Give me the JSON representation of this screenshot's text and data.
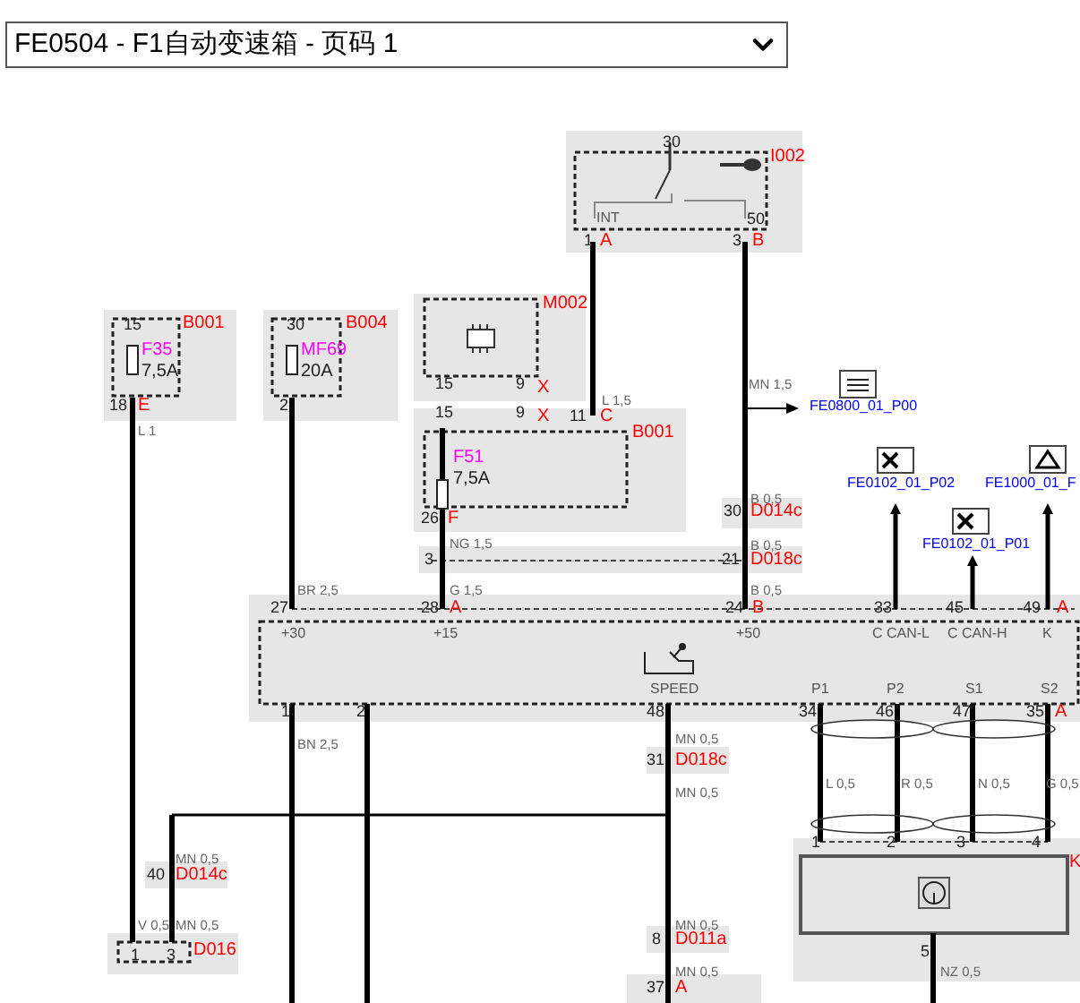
{
  "selector": {
    "value": "FE0504 - F1自动变速箱 - 页码 1"
  },
  "labels": [
    {
      "text": "30",
      "kind": "pin"
    },
    {
      "text": "I002",
      "kind": "connector"
    },
    {
      "text": "INT",
      "kind": "signal"
    },
    {
      "text": "50",
      "kind": "pin"
    },
    {
      "text": "1",
      "kind": "pin"
    },
    {
      "text": "A",
      "kind": "connector"
    },
    {
      "text": "3",
      "kind": "pin"
    },
    {
      "text": "B",
      "kind": "connector"
    },
    {
      "text": "15",
      "kind": "pin"
    },
    {
      "text": "F35",
      "kind": "fuse"
    },
    {
      "text": "7,5A",
      "kind": "rating"
    },
    {
      "text": "B001",
      "kind": "connector"
    },
    {
      "text": "18",
      "kind": "pin"
    },
    {
      "text": "E",
      "kind": "connector"
    },
    {
      "text": "L 1",
      "kind": "wire"
    },
    {
      "text": "30",
      "kind": "pin"
    },
    {
      "text": "MF69",
      "kind": "fuse"
    },
    {
      "text": "20A",
      "kind": "rating"
    },
    {
      "text": "B004",
      "kind": "connector"
    },
    {
      "text": "2",
      "kind": "pin"
    },
    {
      "text": "M002",
      "kind": "connector"
    },
    {
      "text": "15",
      "kind": "pin"
    },
    {
      "text": "9",
      "kind": "pin"
    },
    {
      "text": "X",
      "kind": "connector"
    },
    {
      "text": "L 1,5",
      "kind": "wire"
    },
    {
      "text": "15",
      "kind": "pin"
    },
    {
      "text": "9",
      "kind": "pin"
    },
    {
      "text": "X",
      "kind": "connector"
    },
    {
      "text": "11",
      "kind": "pin"
    },
    {
      "text": "C",
      "kind": "connector"
    },
    {
      "text": "B001",
      "kind": "connector"
    },
    {
      "text": "F51",
      "kind": "fuse"
    },
    {
      "text": "7,5A",
      "kind": "rating"
    },
    {
      "text": "26",
      "kind": "pin"
    },
    {
      "text": "F",
      "kind": "connector"
    },
    {
      "text": "MN 1,5",
      "kind": "wire"
    },
    {
      "text": "FE0800_01_P00",
      "kind": "reference"
    },
    {
      "text": "FE0102_01_P02",
      "kind": "reference"
    },
    {
      "text": "FE1000_01_F",
      "kind": "reference"
    },
    {
      "text": "B 0,5",
      "kind": "wire"
    },
    {
      "text": "30",
      "kind": "pin"
    },
    {
      "text": "D014c",
      "kind": "connector"
    },
    {
      "text": "NG 1,5",
      "kind": "wire"
    },
    {
      "text": "B 0,5",
      "kind": "wire"
    },
    {
      "text": "FE0102_01_P01",
      "kind": "reference"
    },
    {
      "text": "3",
      "kind": "pin"
    },
    {
      "text": "21",
      "kind": "pin"
    },
    {
      "text": "D018c",
      "kind": "connector"
    },
    {
      "text": "BR 2,5",
      "kind": "wire"
    },
    {
      "text": "G 1,5",
      "kind": "wire"
    },
    {
      "text": "B 0,5",
      "kind": "wire"
    },
    {
      "text": "27",
      "kind": "pin"
    },
    {
      "text": "28",
      "kind": "pin"
    },
    {
      "text": "A",
      "kind": "connector"
    },
    {
      "text": "24",
      "kind": "pin"
    },
    {
      "text": "B",
      "kind": "connector"
    },
    {
      "text": "33",
      "kind": "pin"
    },
    {
      "text": "45",
      "kind": "pin"
    },
    {
      "text": "49",
      "kind": "pin"
    },
    {
      "text": "A",
      "kind": "connector"
    },
    {
      "text": "+30",
      "kind": "signal"
    },
    {
      "text": "+15",
      "kind": "signal"
    },
    {
      "text": "+50",
      "kind": "signal"
    },
    {
      "text": "C CAN-L",
      "kind": "signal"
    },
    {
      "text": "C CAN-H",
      "kind": "signal"
    },
    {
      "text": "K",
      "kind": "signal"
    },
    {
      "text": "SPEED",
      "kind": "signal"
    },
    {
      "text": "P1",
      "kind": "signal"
    },
    {
      "text": "P2",
      "kind": "signal"
    },
    {
      "text": "S1",
      "kind": "signal"
    },
    {
      "text": "S2",
      "kind": "signal"
    },
    {
      "text": "1",
      "kind": "pin"
    },
    {
      "text": "2",
      "kind": "pin"
    },
    {
      "text": "48",
      "kind": "pin"
    },
    {
      "text": "34",
      "kind": "pin"
    },
    {
      "text": "46",
      "kind": "pin"
    },
    {
      "text": "47",
      "kind": "pin"
    },
    {
      "text": "35",
      "kind": "pin"
    },
    {
      "text": "A",
      "kind": "connector"
    },
    {
      "text": "BN 2,5",
      "kind": "wire"
    },
    {
      "text": "MN 0,5",
      "kind": "wire"
    },
    {
      "text": "31",
      "kind": "pin"
    },
    {
      "text": "D018c",
      "kind": "connector"
    },
    {
      "text": "L 0,5",
      "kind": "wire"
    },
    {
      "text": "R 0,5",
      "kind": "wire"
    },
    {
      "text": "N 0,5",
      "kind": "wire"
    },
    {
      "text": "G 0,5",
      "kind": "wire"
    },
    {
      "text": "MN 0,5",
      "kind": "wire"
    },
    {
      "text": "1",
      "kind": "pin"
    },
    {
      "text": "2",
      "kind": "pin"
    },
    {
      "text": "3",
      "kind": "pin"
    },
    {
      "text": "4",
      "kind": "pin"
    },
    {
      "text": "K",
      "kind": "connector"
    },
    {
      "text": "MN 0,5",
      "kind": "wire"
    },
    {
      "text": "40",
      "kind": "pin"
    },
    {
      "text": "D014c",
      "kind": "connector"
    },
    {
      "text": "MN 0,5",
      "kind": "wire"
    },
    {
      "text": "8",
      "kind": "pin"
    },
    {
      "text": "D011a",
      "kind": "connector"
    },
    {
      "text": "V 0,5",
      "kind": "wire"
    },
    {
      "text": "MN 0,5",
      "kind": "wire"
    },
    {
      "text": "1",
      "kind": "pin"
    },
    {
      "text": "3",
      "kind": "pin"
    },
    {
      "text": "D016",
      "kind": "connector"
    },
    {
      "text": "5",
      "kind": "pin"
    },
    {
      "text": "NZ 0,5",
      "kind": "wire"
    },
    {
      "text": "MN 0,5",
      "kind": "wire"
    },
    {
      "text": "37",
      "kind": "pin"
    },
    {
      "text": "A",
      "kind": "connector"
    }
  ]
}
